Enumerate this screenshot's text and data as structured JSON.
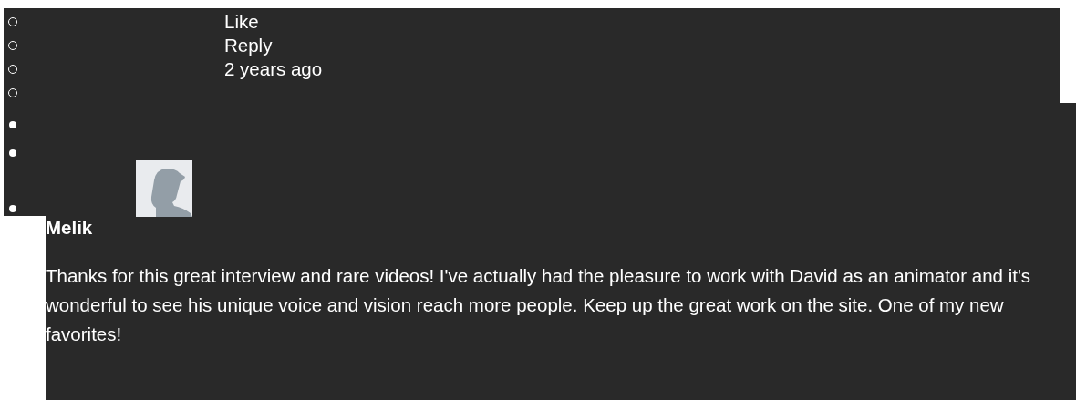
{
  "actions": [
    {
      "label": "Like"
    },
    {
      "label": "Reply"
    },
    {
      "label": "2 years ago"
    }
  ],
  "comment": {
    "author": "Melik",
    "text": "Thanks for this great interview and rare videos! I've actually had the pleasure to work with David as an animator and it's wonderful to see his unique voice and vision reach more people. Keep up the great work on the site. One of my new favorites!"
  }
}
